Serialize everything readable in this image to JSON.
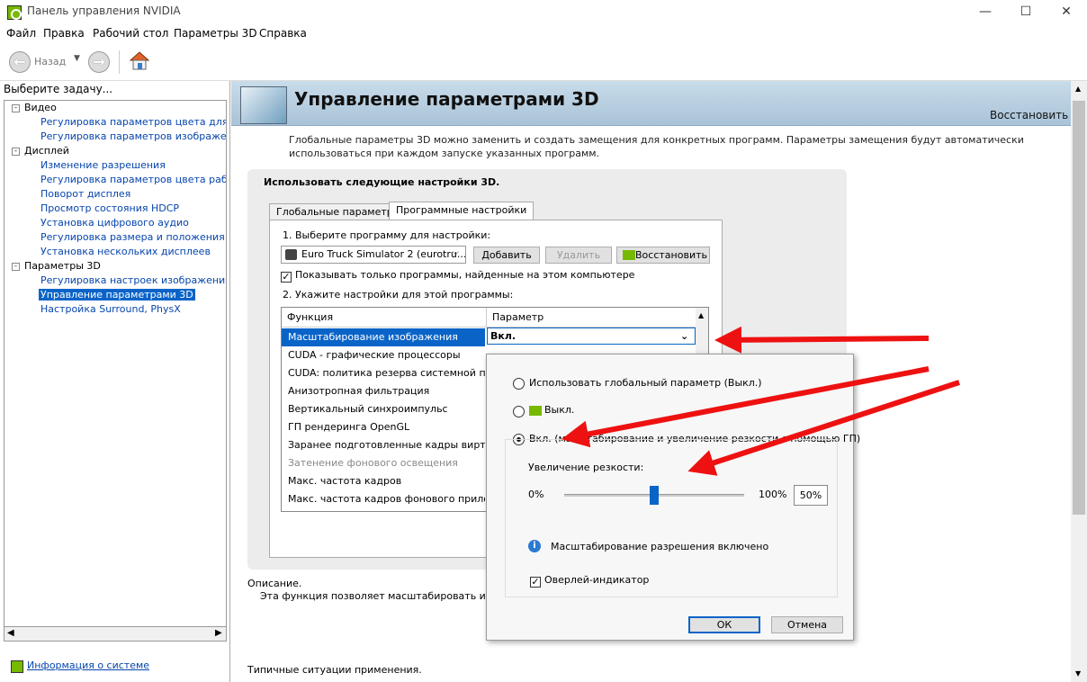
{
  "window": {
    "title": "Панель управления NVIDIA",
    "minimize": "—",
    "maximize": "☐",
    "close": "✕"
  },
  "menu": [
    "Файл",
    "Правка",
    "Рабочий стол",
    "Параметры 3D",
    "Справка"
  ],
  "toolbar": {
    "back_label": "Назад",
    "back_icon": "back-arrow-icon",
    "forward_icon": "forward-arrow-icon",
    "home_icon": "home-icon"
  },
  "sidebar": {
    "header": "Выберите задачу...",
    "tree": [
      {
        "label": "Видео",
        "type": "group"
      },
      {
        "label": "Регулировка параметров цвета для вид",
        "type": "link"
      },
      {
        "label": "Регулировка параметров изображения д",
        "type": "link"
      },
      {
        "label": "Дисплей",
        "type": "group"
      },
      {
        "label": "Изменение разрешения",
        "type": "link"
      },
      {
        "label": "Регулировка параметров цвета рабочег",
        "type": "link"
      },
      {
        "label": "Поворот дисплея",
        "type": "link"
      },
      {
        "label": "Просмотр состояния HDCP",
        "type": "link"
      },
      {
        "label": "Установка цифрового аудио",
        "type": "link"
      },
      {
        "label": "Регулировка размера и положения рабо",
        "type": "link"
      },
      {
        "label": "Установка нескольких дисплеев",
        "type": "link"
      },
      {
        "label": "Параметры 3D",
        "type": "group"
      },
      {
        "label": "Регулировка настроек изображения с пр",
        "type": "link"
      },
      {
        "label": "Управление параметрами 3D",
        "type": "selected"
      },
      {
        "label": "Настройка Surround, PhysX",
        "type": "link"
      }
    ],
    "system_info": "Информация о системе"
  },
  "main": {
    "title": "Управление параметрами 3D",
    "restore": "Восстановить",
    "intro": "Глобальные параметры 3D можно заменить и создать замещения для конкретных программ. Параметры замещения будут автоматически использоваться при каждом запуске указанных программ.",
    "panel_title": "Использовать следующие настройки 3D.",
    "tabs": [
      "Глобальные параметры",
      "Программные настройки"
    ],
    "step1": "1. Выберите программу для настройки:",
    "program": "Euro Truck Simulator 2 (eurotru...",
    "add": "Добавить",
    "delete": "Удалить",
    "restore_btn": "Восстановить",
    "show_only": "Показывать только программы, найденные на этом компьютере",
    "step2": "2. Укажите настройки для этой программы:",
    "col_function": "Функция",
    "col_param": "Параметр",
    "rows": [
      {
        "label": "Масштабирование изображения",
        "state": "selected"
      },
      {
        "label": "CUDA - графические процессоры",
        "state": "normal"
      },
      {
        "label": "CUDA: политика резерва системной пам...",
        "state": "normal"
      },
      {
        "label": "Анизотропная фильтрация",
        "state": "normal"
      },
      {
        "label": "Вертикальный синхроимпульс",
        "state": "normal"
      },
      {
        "label": "ГП рендеринга OpenGL",
        "state": "normal"
      },
      {
        "label": "Заранее подготовленные кадры вирту...",
        "state": "normal"
      },
      {
        "label": "Затенение фонового освещения",
        "state": "disabled"
      },
      {
        "label": "Макс. частота кадров",
        "state": "normal"
      },
      {
        "label": "Макс. частота кадров фонового прило...",
        "state": "normal"
      }
    ],
    "selected_value": "Вкл.",
    "description_label": "Описание.",
    "description_text": "Эта функция позволяет масштабировать и повыш",
    "typical": "Типичные ситуации применения."
  },
  "popup": {
    "opt_global": "Использовать глобальный параметр (Выкл.)",
    "opt_off": "Выкл.",
    "opt_on": "Вкл. (масштабирование и увеличение резкости с помощью ГП)",
    "sharpen_label": "Увеличение резкости:",
    "min": "0%",
    "max": "100%",
    "sharpen_value": 0.5,
    "sharpen_text": "50%",
    "info": "Масштабирование разрешения включено",
    "overlay": "Оверлей-индикатор",
    "ok": "ОК",
    "cancel": "Отмена"
  },
  "colors": {
    "accent": "#0a64c8",
    "nvidia": "#76b900",
    "arrow": "#ee1111"
  }
}
